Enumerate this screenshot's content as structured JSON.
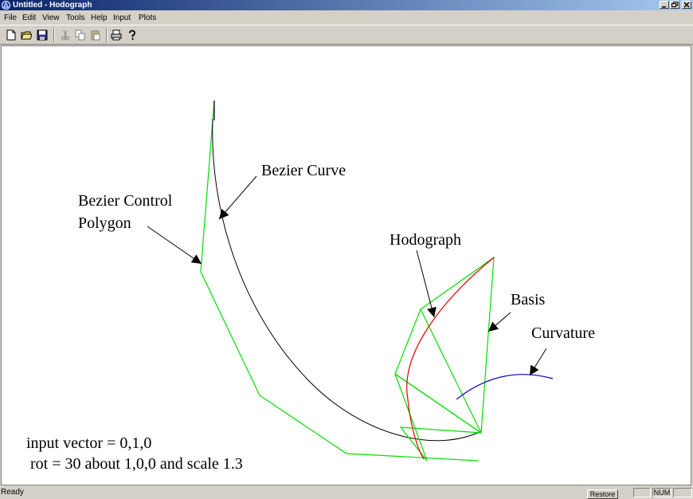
{
  "window": {
    "title": "Untitled - Hodograph"
  },
  "menu": [
    "File",
    "Edit",
    "View",
    "Tools",
    "Help",
    "Input",
    "Plots"
  ],
  "toolbar": {
    "buttons": [
      "new",
      "open",
      "save",
      "cut",
      "copy",
      "paste",
      "print",
      "help"
    ]
  },
  "plot": {
    "labels": {
      "bezier_curve": "Bezier Curve",
      "control_polygon_line1": "Bezier Control",
      "control_polygon_line2": "Polygon",
      "hodograph": "Hodograph",
      "basis": "Basis",
      "curvature": "Curvature"
    },
    "info_line1": "input vector = 0,1,0",
    "info_line2": " rot = 30 about 1,0,0 and scale 1.3",
    "colors": {
      "control_polygon": "#00e000",
      "bezier_curve": "#000000",
      "hodograph": "#e00000",
      "curvature": "#0000cc"
    }
  },
  "status": {
    "text": "Ready",
    "restore_button": "Restore",
    "num": "NUM"
  }
}
